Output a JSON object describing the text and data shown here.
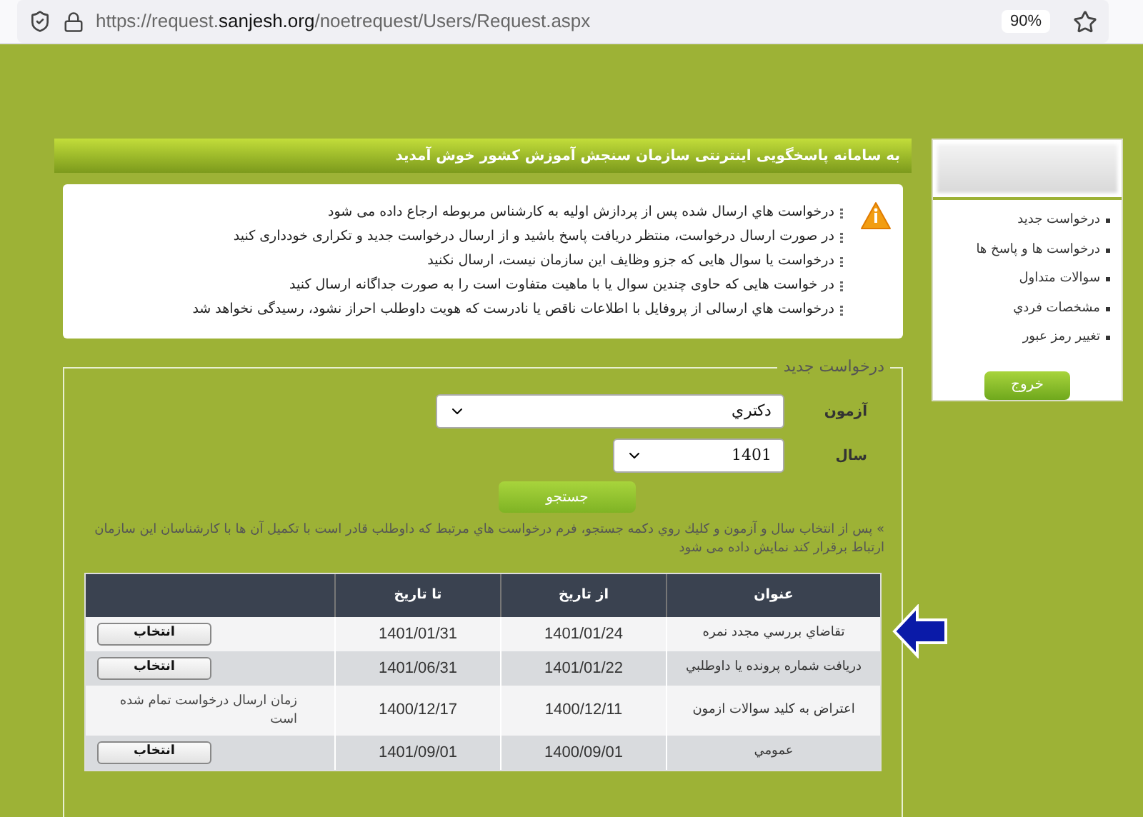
{
  "browser": {
    "url_prefix": "https://request.",
    "url_domain": "sanjesh.org",
    "url_path": "/noetrequest/Users/Request.aspx",
    "zoom": "90%"
  },
  "header": {
    "title": "به سامانه پاسخگویی اینترنتی سازمان سنجش آموزش کشور خوش آمدید"
  },
  "notices": [
    "درخواست هاي ارسال شده پس از پردازش اولیه به کارشناس مربوطه ارجاع داده می شود",
    "در صورت ارسال درخواست، منتظر دریافت پاسخ باشید و از ارسال درخواست جدید و تکراری خودداری کنید",
    "درخواست یا سوال هایی که جزو وظایف این سازمان نیست، ارسال نکنید",
    "در خواست هایی که حاوی چندین سوال یا با ماهیت متفاوت است را به صورت جداگانه ارسال کنید",
    "درخواست هاي ارسالی از پروفایل با اطلاعات ناقص یا نادرست که هویت داوطلب احراز نشود، رسیدگی نخواهد شد"
  ],
  "form": {
    "legend": "درخواست جدید",
    "fields": [
      {
        "label": "آزمون",
        "value": "دکتري"
      },
      {
        "label": "سال",
        "value": "1401"
      }
    ],
    "search_button": "جستجو",
    "help": "» پس از انتخاب سال و آزمون و کلیك روي دکمه جستجو، فرم درخواست هاي مرتبط که داوطلب قادر است با تکمیل آن ها با کارشناسان این سازمان ارتباط برقرار کند نمایش داده می شود"
  },
  "table": {
    "columns": [
      "عنوان",
      "از تاريخ",
      "تا تاريخ"
    ],
    "rows": [
      {
        "title": "تقاضاي بررسي مجدد نمره",
        "from": "1401/01/24",
        "to": "1401/01/31",
        "kind": "button",
        "action": "انتخاب"
      },
      {
        "title": "دریافت شماره پرونده یا داوطلبي",
        "from": "1401/01/22",
        "to": "1401/06/31",
        "kind": "button",
        "action": "انتخاب"
      },
      {
        "title": "اعتراض به کلید سوالات ازمون",
        "from": "1400/12/11",
        "to": "1400/12/17",
        "kind": "note",
        "action": "زمان ارسال درخواست تمام شده است"
      },
      {
        "title": "عمومي",
        "from": "1400/09/01",
        "to": "1401/09/01",
        "kind": "button",
        "action": "انتخاب"
      }
    ]
  },
  "sidebar": {
    "items": [
      "درخواست جدید",
      "درخواست ها و پاسخ ها",
      "سوالات متداول",
      "مشخصات فردي",
      "تغییر رمز عبور"
    ],
    "logout": "خروج"
  }
}
